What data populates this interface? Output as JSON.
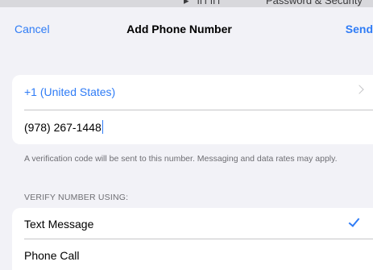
{
  "background_text": {
    "left": "▸   ıl ı ıl ı",
    "right": "Password & Security"
  },
  "navbar": {
    "cancel_label": "Cancel",
    "title": "Add Phone Number",
    "send_label": "Send"
  },
  "phone": {
    "country": "+1 (United States)",
    "number": "(978) 267-1448"
  },
  "footnote": "A verification code will be sent to this number. Messaging and data rates may apply.",
  "verify": {
    "header": "VERIFY NUMBER USING:",
    "options": [
      {
        "label": "Text Message",
        "selected": true
      },
      {
        "label": "Phone Call",
        "selected": false
      }
    ]
  },
  "colors": {
    "accent": "#2f7cf6",
    "background": "#f2f2f7",
    "secondary_text": "#6e6e73"
  }
}
